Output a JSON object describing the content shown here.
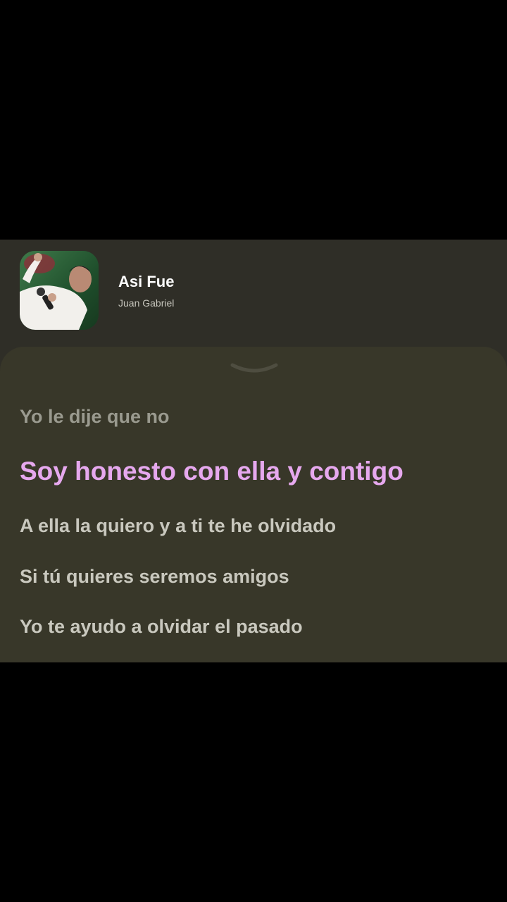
{
  "player": {
    "song_title": "Asi Fue",
    "artist": "Juan Gabriel",
    "album_art_icon": "album-art-photo",
    "collapse_icon": "chevron-down-icon"
  },
  "lyrics": {
    "lines": [
      {
        "text": "Yo le dije que no",
        "state": "past"
      },
      {
        "text": "Soy honesto con ella y contigo",
        "state": "current"
      },
      {
        "text": "A ella la quiero y a ti te he olvidado",
        "state": "upcoming"
      },
      {
        "text": "Si tú quieres seremos amigos",
        "state": "upcoming"
      },
      {
        "text": "Yo te ayudo a olvidar el pasado",
        "state": "upcoming"
      }
    ],
    "highlight_color": "#e6a8ee",
    "dim_color": "#9a9a8f",
    "text_color": "#c9c8be"
  },
  "colors": {
    "page_background": "#000000",
    "header_background": "#2f2e27",
    "panel_background": "#383729"
  }
}
